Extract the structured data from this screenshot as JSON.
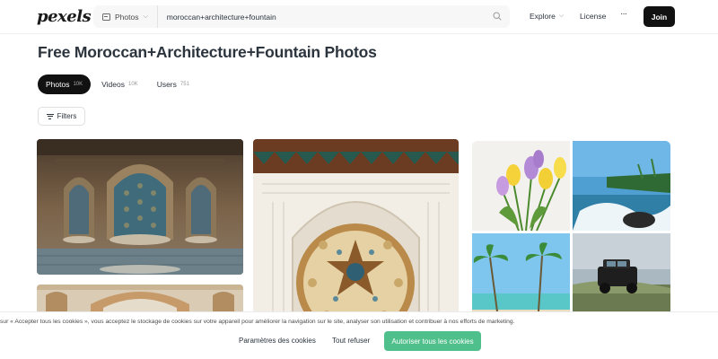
{
  "header": {
    "logo": "pexels",
    "search_type": "Photos",
    "search_value": "moroccan+architecture+fountain",
    "nav": {
      "explore": "Explore",
      "license": "License",
      "more": "···"
    },
    "join": "Join"
  },
  "main": {
    "title": "Free Moroccan+Architecture+Fountain Photos",
    "tabs": [
      {
        "label": "Photos",
        "count": "10K",
        "active": true
      },
      {
        "label": "Videos",
        "count": "10K",
        "active": false
      },
      {
        "label": "Users",
        "count": "751",
        "active": false
      }
    ],
    "filters": "Filters"
  },
  "cookie_banner": {
    "text": "sur « Accepter tous les cookies », vous acceptez le stockage de cookies sur votre appareil pour améliorer la navigation sur le site, analyser son utilisation et contribuer à nos efforts de marketing.",
    "settings": "Paramètres des cookies",
    "refuse": "Tout refuser",
    "accept": "Autoriser tous les cookies"
  },
  "colors": {
    "accent_green": "#4fbf8b",
    "primary_dark": "#111111"
  },
  "icons": [
    "image-icon",
    "chevron-down-icon",
    "search-icon",
    "filter-icon"
  ]
}
